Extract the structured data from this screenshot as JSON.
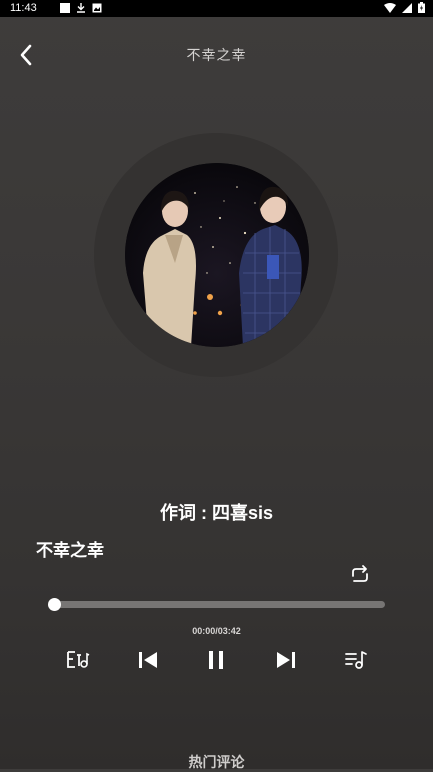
{
  "status_bar": {
    "time": "11:43"
  },
  "header": {
    "title": "不幸之幸"
  },
  "player": {
    "lyric_line": "作词 : 四喜sis",
    "song_title": "不幸之幸",
    "elapsed": "00:00",
    "duration": "03:42",
    "time_readout": "00:00/03:42",
    "progress_fraction": 0.0
  },
  "icons": {
    "back": "chevron-left-icon",
    "repeat": "repeat-icon",
    "lyrics_toggle": "lyrics-icon",
    "previous": "skip-previous-icon",
    "pause": "pause-icon",
    "next": "skip-next-icon",
    "playlist": "playlist-icon"
  },
  "comments": {
    "hot_label": "热门评论"
  },
  "colors": {
    "background": "#3a3837",
    "track": "#777574",
    "accent": "#ffffff"
  }
}
